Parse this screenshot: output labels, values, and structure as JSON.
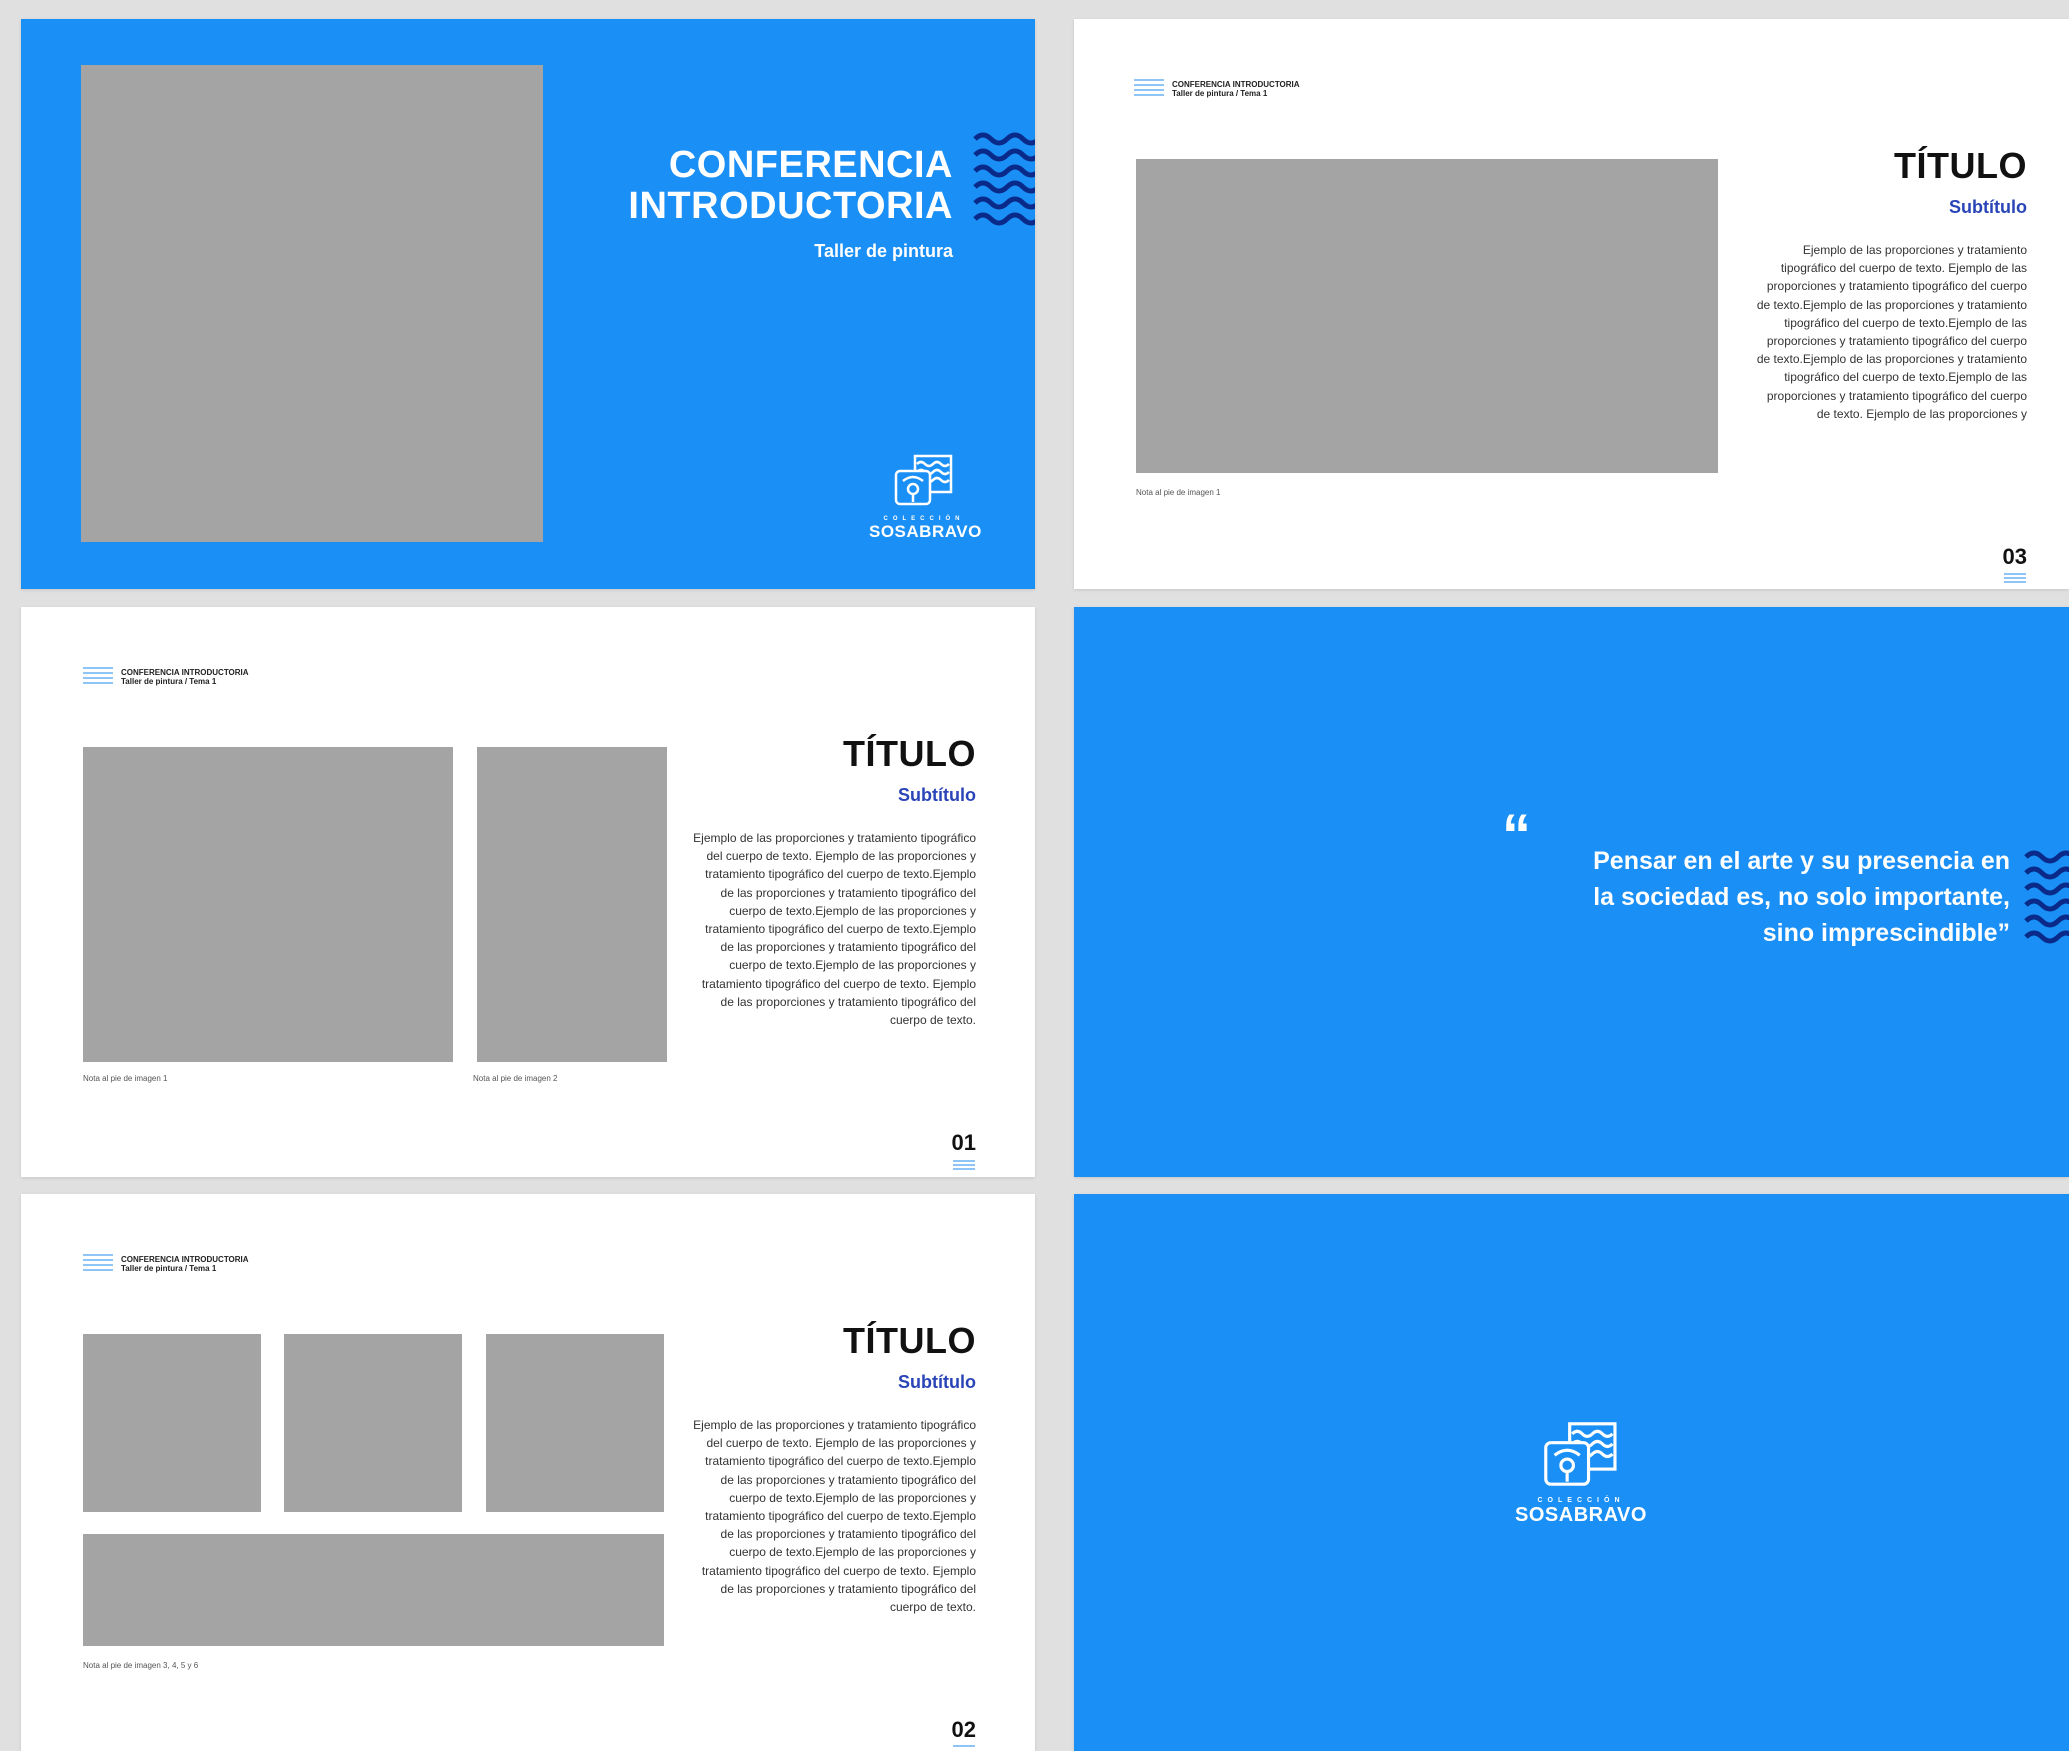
{
  "cover": {
    "title_line1": "CONFERENCIA",
    "title_line2": "INTRODUCTORIA",
    "subtitle": "Taller de pintura"
  },
  "logo": {
    "coleccion": "COLECCIÓN",
    "name": "SOSABRAVO"
  },
  "header": {
    "line1": "CONFERENCIA INTRODUCTORIA",
    "line2": "Taller de pintura / Tema 1"
  },
  "slide03": {
    "title": "TÍTULO",
    "subtitle": "Subtítulo",
    "body": "Ejemplo de las proporciones y tratamiento tipográfico del cuerpo de texto. Ejemplo de las proporciones y tratamiento tipográfico del cuerpo de texto.Ejemplo de las proporciones y tratamiento tipográfico del cuerpo de texto.Ejemplo de las proporciones y tratamiento tipográfico del cuerpo de texto.Ejemplo de las proporciones y tratamiento tipográfico del cuerpo de texto.Ejemplo de las proporciones y tratamiento tipográfico del cuerpo de texto. Ejemplo de las proporciones y",
    "caption1": "Nota al pie de imagen 1",
    "page": "03"
  },
  "slide01": {
    "title": "TÍTULO",
    "subtitle": "Subtítulo",
    "body": "Ejemplo de las proporciones y tratamiento tipográfico del cuerpo de texto. Ejemplo de las proporciones y tratamiento tipográfico del cuerpo de texto.Ejemplo de las proporciones y tratamiento tipográfico del cuerpo de texto.Ejemplo de las proporciones y tratamiento tipográfico del cuerpo de texto.Ejemplo de las proporciones y tratamiento tipográfico del cuerpo de texto.Ejemplo de las proporciones y tratamiento tipográfico del cuerpo de texto. Ejemplo de las proporciones y tratamiento tipográfico del cuerpo de texto.",
    "caption1": "Nota al pie de imagen 1",
    "caption2": "Nota al pie de imagen 2",
    "page": "01"
  },
  "slide02": {
    "title": "TÍTULO",
    "subtitle": "Subtítulo",
    "body": "Ejemplo de las proporciones y tratamiento tipográfico del cuerpo de texto. Ejemplo de las proporciones y tratamiento tipográfico del cuerpo de texto.Ejemplo de las proporciones y tratamiento tipográfico del cuerpo de texto.Ejemplo de las proporciones y tratamiento tipográfico del cuerpo de texto.Ejemplo de las proporciones y tratamiento tipográfico del cuerpo de texto.Ejemplo de las proporciones y tratamiento tipográfico del cuerpo de texto. Ejemplo de las proporciones y tratamiento tipográfico del cuerpo de texto.",
    "caption1": "Nota al pie de imagen 3, 4, 5 y 6",
    "page": "02"
  },
  "quote": {
    "mark": "“",
    "line1": "Pensar en el arte y su presencia en",
    "line2": "la sociedad es, no solo importante,",
    "line3": "sino imprescindible”"
  },
  "colors": {
    "brand_blue": "#1a8ff5",
    "subtitle_blue": "#2a45b8",
    "placeholder_gray": "#a4a4a4",
    "light_blue": "#8fc4f7"
  }
}
